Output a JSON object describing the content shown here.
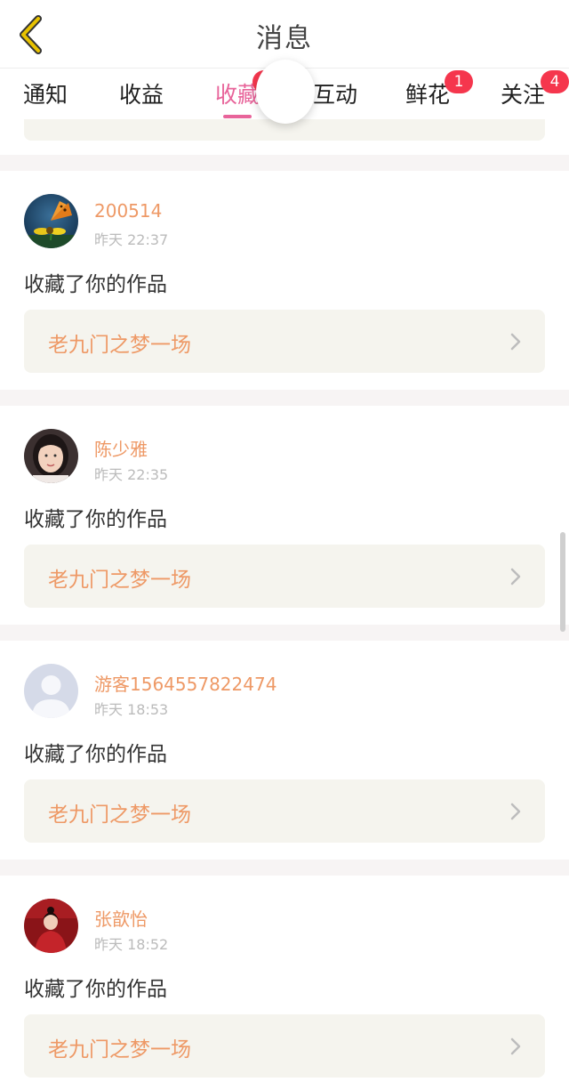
{
  "header": {
    "title": "消息"
  },
  "tabs": [
    {
      "label": "通知",
      "badge": ""
    },
    {
      "label": "收益",
      "badge": ""
    },
    {
      "label": "收藏",
      "badge": "",
      "active": true
    },
    {
      "label": "互动",
      "badge": ""
    },
    {
      "label": "鲜花",
      "badge": "1"
    },
    {
      "label": "关注",
      "badge": "4"
    }
  ],
  "messages": [
    {
      "username": "200514",
      "time": "昨天 22:37",
      "action": "收藏了你的作品",
      "work_title": "老九门之梦一场"
    },
    {
      "username": "陈少雅",
      "time": "昨天 22:35",
      "action": "收藏了你的作品",
      "work_title": "老九门之梦一场"
    },
    {
      "username": "游客1564557822474",
      "time": "昨天 18:53",
      "action": "收藏了你的作品",
      "work_title": "老九门之梦一场"
    },
    {
      "username": "张歆怡",
      "time": "昨天 18:52",
      "action": "收藏了你的作品",
      "work_title": "老九门之梦一场"
    }
  ],
  "colors": {
    "accent_pink": "#e8649a",
    "name_orange": "#ee9966",
    "badge_red": "#f5364d",
    "back_yellow": "#e8c200"
  },
  "icons": {
    "back": "chevron-left-icon",
    "row_arrow": "chevron-right-icon"
  }
}
